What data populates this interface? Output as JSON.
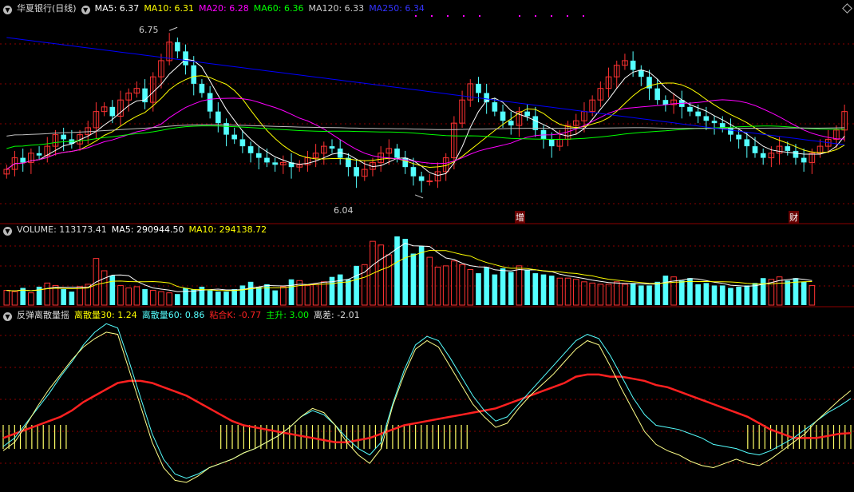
{
  "header": {
    "title": "华夏银行(日线)",
    "ma5": "MA5: 6.37",
    "ma10": "MA10: 6.31",
    "ma20": "MA20: 6.28",
    "ma60": "MA60: 6.36",
    "ma120": "MA120: 6.33",
    "ma250": "MA250: 6.34"
  },
  "volume_header": {
    "label": "VOLUME: 113173.41",
    "ma5": "MA5: 290944.50",
    "ma10": "MA10: 294138.72"
  },
  "indicator_header": {
    "name": "反弹离散量摇",
    "d30": "离散量30: 1.24",
    "d60": "离散量60: 0.86",
    "nian": "粘合K: -0.77",
    "zhu": "主升: 3.00",
    "lichai": "离差: -2.01"
  },
  "annotations": {
    "high": "6.75",
    "low": "6.04",
    "tag1": "增",
    "tag2": "财"
  },
  "colors": {
    "up": "#ff3232",
    "down": "#54ffff",
    "ma5": "#ffffff",
    "ma10": "#ffff00",
    "ma20": "#ff00ff",
    "ma60": "#00ff00",
    "ma120": "#c0c0c0",
    "ma250": "#0000ff",
    "grid": "#8b0000",
    "red_line": "#ff2020"
  },
  "chart_data": [
    {
      "type": "candlestick",
      "title": "华夏银行(日线)",
      "ylim": [
        5.95,
        6.82
      ],
      "price_high": 6.75,
      "price_low": 6.04,
      "close": [
        6.15,
        6.2,
        6.18,
        6.22,
        6.21,
        6.25,
        6.3,
        6.28,
        6.26,
        6.3,
        6.33,
        6.4,
        6.42,
        6.38,
        6.45,
        6.48,
        6.5,
        6.44,
        6.55,
        6.62,
        6.7,
        6.66,
        6.6,
        6.52,
        6.48,
        6.4,
        6.35,
        6.3,
        6.28,
        6.25,
        6.22,
        6.2,
        6.18,
        6.17,
        6.18,
        6.16,
        6.17,
        6.2,
        6.22,
        6.25,
        6.24,
        6.2,
        6.16,
        6.12,
        6.15,
        6.18,
        6.22,
        6.24,
        6.2,
        6.16,
        6.12,
        6.1,
        6.1,
        6.14,
        6.2,
        6.35,
        6.45,
        6.52,
        6.48,
        6.44,
        6.4,
        6.36,
        6.34,
        6.4,
        6.38,
        6.32,
        6.28,
        6.25,
        6.28,
        6.34,
        6.36,
        6.4,
        6.45,
        6.5,
        6.55,
        6.6,
        6.62,
        6.58,
        6.55,
        6.5,
        6.45,
        6.43,
        6.45,
        6.42,
        6.4,
        6.38,
        6.36,
        6.35,
        6.33,
        6.3,
        6.28,
        6.25,
        6.22,
        6.2,
        6.22,
        6.25,
        6.23,
        6.2,
        6.18,
        6.22,
        6.25,
        6.28,
        6.32,
        6.4
      ]
    },
    {
      "type": "bar",
      "title": "VOLUME",
      "series": [
        {
          "name": "VOLUME",
          "values": [
            120,
            110,
            140,
            100,
            150,
            180,
            160,
            130,
            110,
            150,
            170,
            380,
            280,
            240,
            160,
            140,
            150,
            130,
            120,
            110,
            100,
            90,
            140,
            130,
            150,
            120,
            110,
            110,
            130,
            160,
            190,
            150,
            170,
            120,
            150,
            210,
            200,
            160,
            170,
            190,
            230,
            250,
            210,
            320,
            330,
            520,
            490,
            410,
            560,
            540,
            420,
            480,
            390,
            310,
            320,
            360,
            330,
            290,
            260,
            310,
            250,
            300,
            270,
            320,
            290,
            260,
            250,
            240,
            220,
            220,
            210,
            190,
            180,
            170,
            170,
            190,
            170,
            180,
            160,
            160,
            190,
            240,
            230,
            200,
            220,
            170,
            180,
            160,
            160,
            140,
            150,
            160,
            180,
            220,
            210,
            230,
            200,
            220,
            190,
            160
          ]
        }
      ],
      "ma5": 290944.5,
      "ma10": 294138.72
    },
    {
      "type": "line",
      "title": "反弹离散量摇",
      "series": [
        {
          "name": "离散量30",
          "values": [
            -1.6,
            -1.2,
            -0.4,
            0.5,
            1.3,
            2.0,
            2.7,
            3.3,
            3.7,
            4.0,
            3.9,
            2.2,
            0.5,
            -1.2,
            -2.4,
            -3.0,
            -3.1,
            -2.8,
            -2.4,
            -2.2,
            -2.0,
            -1.7,
            -1.5,
            -1.2,
            -0.9,
            -0.5,
            0.0,
            0.4,
            0.2,
            -0.4,
            -1.2,
            -1.8,
            -2.2,
            -1.5,
            0.5,
            2.0,
            3.2,
            3.6,
            3.3,
            2.4,
            1.5,
            0.6,
            0.0,
            -0.5,
            -0.3,
            0.4,
            1.0,
            1.5,
            2.0,
            2.6,
            3.2,
            3.6,
            3.4,
            2.4,
            1.3,
            0.3,
            -0.7,
            -1.3,
            -1.6,
            -1.8,
            -2.1,
            -2.3,
            -2.4,
            -2.2,
            -2.0,
            -2.2,
            -2.3,
            -2.0,
            -1.6,
            -1.2,
            -0.8,
            -0.2,
            0.3,
            0.8,
            1.24
          ]
        },
        {
          "name": "离散量60",
          "values": [
            -1.4,
            -1.0,
            -0.3,
            0.4,
            1.1,
            1.9,
            2.6,
            3.4,
            4.0,
            4.4,
            4.2,
            2.6,
            0.9,
            -0.8,
            -2.0,
            -2.7,
            -2.9,
            -2.7,
            -2.4,
            -2.2,
            -2.0,
            -1.7,
            -1.5,
            -1.2,
            -0.9,
            -0.5,
            0.0,
            0.3,
            0.1,
            -0.4,
            -1.0,
            -1.5,
            -1.8,
            -1.2,
            0.6,
            2.2,
            3.4,
            3.8,
            3.6,
            2.8,
            1.9,
            1.0,
            0.3,
            -0.2,
            0.0,
            0.6,
            1.2,
            1.8,
            2.4,
            3.0,
            3.6,
            3.9,
            3.7,
            2.9,
            1.9,
            0.9,
            0.1,
            -0.4,
            -0.5,
            -0.6,
            -0.8,
            -1.0,
            -1.3,
            -1.4,
            -1.5,
            -1.7,
            -1.8,
            -1.6,
            -1.3,
            -1.0,
            -0.6,
            -0.2,
            0.2,
            0.5,
            0.86
          ]
        },
        {
          "name": "粘合K",
          "values": [
            -1.0,
            -0.8,
            -0.6,
            -0.4,
            -0.2,
            0.0,
            0.3,
            0.7,
            1.0,
            1.3,
            1.6,
            1.7,
            1.7,
            1.6,
            1.4,
            1.2,
            1.0,
            0.7,
            0.4,
            0.1,
            -0.2,
            -0.4,
            -0.5,
            -0.6,
            -0.7,
            -0.8,
            -0.9,
            -1.0,
            -1.1,
            -1.2,
            -1.2,
            -1.1,
            -1.0,
            -0.8,
            -0.6,
            -0.4,
            -0.3,
            -0.2,
            -0.1,
            0.0,
            0.1,
            0.2,
            0.3,
            0.4,
            0.6,
            0.8,
            1.0,
            1.2,
            1.4,
            1.6,
            1.9,
            2.0,
            2.0,
            1.9,
            1.9,
            1.8,
            1.7,
            1.5,
            1.4,
            1.2,
            1.0,
            0.8,
            0.6,
            0.4,
            0.2,
            0.0,
            -0.3,
            -0.6,
            -0.8,
            -1.0,
            -1.0,
            -1.0,
            -0.9,
            -0.8,
            -0.77
          ]
        }
      ],
      "ylim": [
        -3.4,
        4.6
      ]
    }
  ]
}
